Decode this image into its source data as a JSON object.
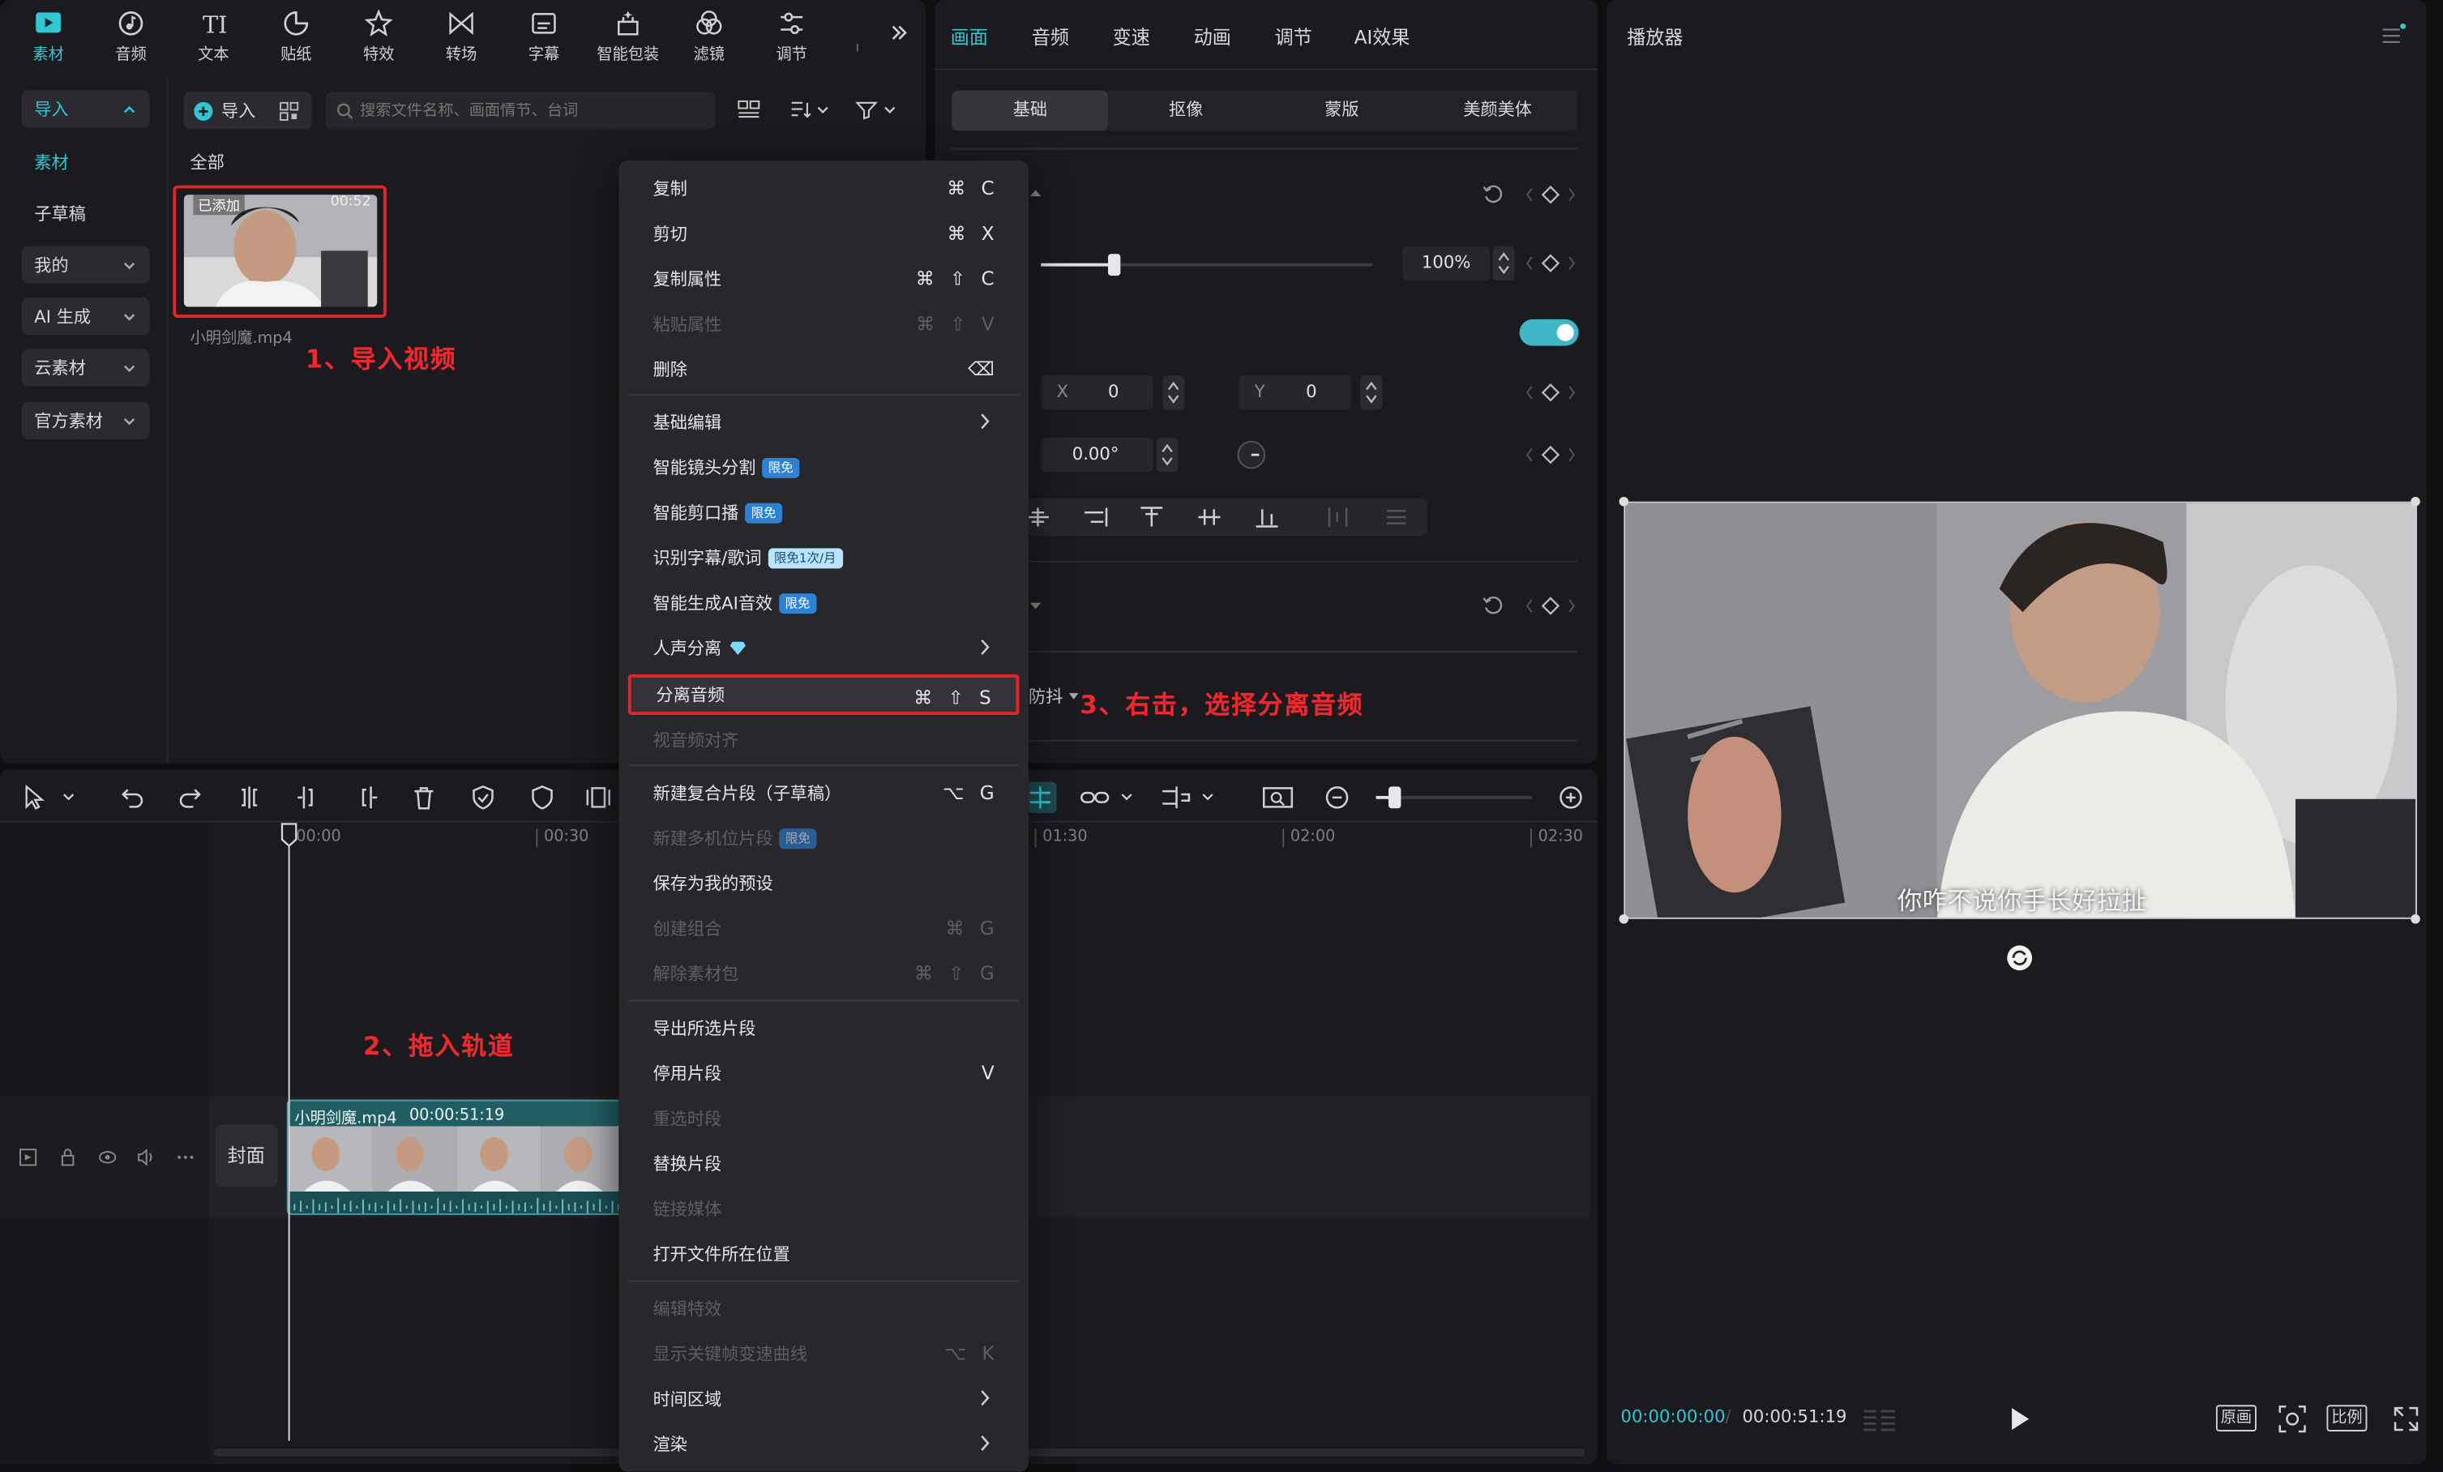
{
  "toolbar": {
    "items": [
      {
        "label": "素材",
        "icon": "media-icon",
        "active": true
      },
      {
        "label": "音频",
        "icon": "audio-icon"
      },
      {
        "label": "文本",
        "icon": "text-icon"
      },
      {
        "label": "贴纸",
        "icon": "sticker-icon"
      },
      {
        "label": "特效",
        "icon": "effects-icon"
      },
      {
        "label": "转场",
        "icon": "transition-icon"
      },
      {
        "label": "字幕",
        "icon": "subtitle-icon"
      },
      {
        "label": "智能包装",
        "icon": "smart-pack-icon"
      },
      {
        "label": "滤镜",
        "icon": "filter-icon"
      },
      {
        "label": "调节",
        "icon": "adjust-icon"
      }
    ],
    "more_icon": "double-chevron-right-icon"
  },
  "sidebar": {
    "import_label": "导入",
    "items": [
      "素材",
      "子草稿",
      "我的",
      "AI 生成",
      "云素材",
      "官方素材"
    ]
  },
  "media": {
    "import_button": "导入",
    "search_placeholder": "搜索文件名称、画面情节、台词",
    "filter_all": "全部",
    "clip": {
      "badge": "已添加",
      "duration": "00:52",
      "filename": "小明剑魔.mp4"
    }
  },
  "annotations": {
    "step1": "1、导入视频",
    "step2": "2、拖入轨道",
    "step3": "3、右击，选择分离音频"
  },
  "inspector": {
    "tabs": [
      "画面",
      "音频",
      "变速",
      "动画",
      "调节",
      "AI效果"
    ],
    "active_tab": "画面",
    "subtabs": [
      "基础",
      "抠像",
      "蒙版",
      "美颜美体"
    ],
    "scale_value": "100%",
    "scale_fraction": 0.22,
    "pos_x_label": "X",
    "pos_x": "0",
    "pos_y_label": "Y",
    "pos_y": "0",
    "rotation": "0.00°",
    "stabilize_partial": "防抖"
  },
  "context_menu": {
    "items": [
      {
        "label": "复制",
        "keys": [
          "⌘",
          "C"
        ]
      },
      {
        "label": "剪切",
        "keys": [
          "⌘",
          "X"
        ]
      },
      {
        "label": "复制属性",
        "keys": [
          "⌘",
          "⇧",
          "C"
        ]
      },
      {
        "label": "粘贴属性",
        "keys": [
          "⌘",
          "⇧",
          "V"
        ],
        "disabled": true
      },
      {
        "label": "删除",
        "keys": [
          "⌫"
        ]
      },
      {
        "label": "基础编辑",
        "submenu": true
      },
      {
        "label": "智能镜头分割",
        "badge": "限免"
      },
      {
        "label": "智能剪口播",
        "badge": "限免"
      },
      {
        "label": "识别字幕/歌词",
        "badge": "限免1次/月",
        "badge_light": true
      },
      {
        "label": "智能生成AI音效",
        "badge": "限免"
      },
      {
        "label": "人声分离",
        "submenu": true,
        "vip": true
      },
      {
        "label": "分离音频",
        "keys": [
          "⌘",
          "⇧",
          "S"
        ],
        "highlight": true
      },
      {
        "label": "视音频对齐",
        "disabled": true
      },
      {
        "label": "新建复合片段（子草稿）",
        "keys": [
          "⌥",
          "G"
        ]
      },
      {
        "label": "新建多机位片段",
        "badge": "限免",
        "disabled": true
      },
      {
        "label": "保存为我的预设"
      },
      {
        "label": "创建组合",
        "keys": [
          "⌘",
          "G"
        ],
        "disabled": true
      },
      {
        "label": "解除素材包",
        "keys": [
          "⌘",
          "⇧",
          "G"
        ],
        "disabled": true
      },
      {
        "label": "导出所选片段"
      },
      {
        "label": "停用片段",
        "keys": [
          "V"
        ]
      },
      {
        "label": "重选时段",
        "disabled": true
      },
      {
        "label": "替换片段"
      },
      {
        "label": "链接媒体",
        "disabled": true
      },
      {
        "label": "打开文件所在位置"
      },
      {
        "label": "编辑特效",
        "disabled": true
      },
      {
        "label": "显示关键帧变速曲线",
        "keys": [
          "⌥",
          "K"
        ],
        "disabled": true
      },
      {
        "label": "时间区域",
        "submenu": true
      },
      {
        "label": "渲染",
        "submenu": true
      }
    ]
  },
  "timeline": {
    "ruler": [
      "00:00",
      "00:30",
      "01:30",
      "02:00",
      "02:30"
    ],
    "cover_label": "封面",
    "clip_name": "小明剑魔.mp4",
    "clip_duration": "00:00:51:19"
  },
  "player": {
    "title": "播放器",
    "subtitle_text": "你咋不说你手长好拉扯",
    "current_time": "00:00:00:00",
    "total_time": "00:00:51:19",
    "buttons": {
      "original": "原画",
      "ratio": "比例"
    }
  },
  "colors": {
    "accent": "#32c5d2",
    "annotation": "#f0282e",
    "highlight_border": "#e0262a",
    "panel": "#1b1b1f"
  }
}
